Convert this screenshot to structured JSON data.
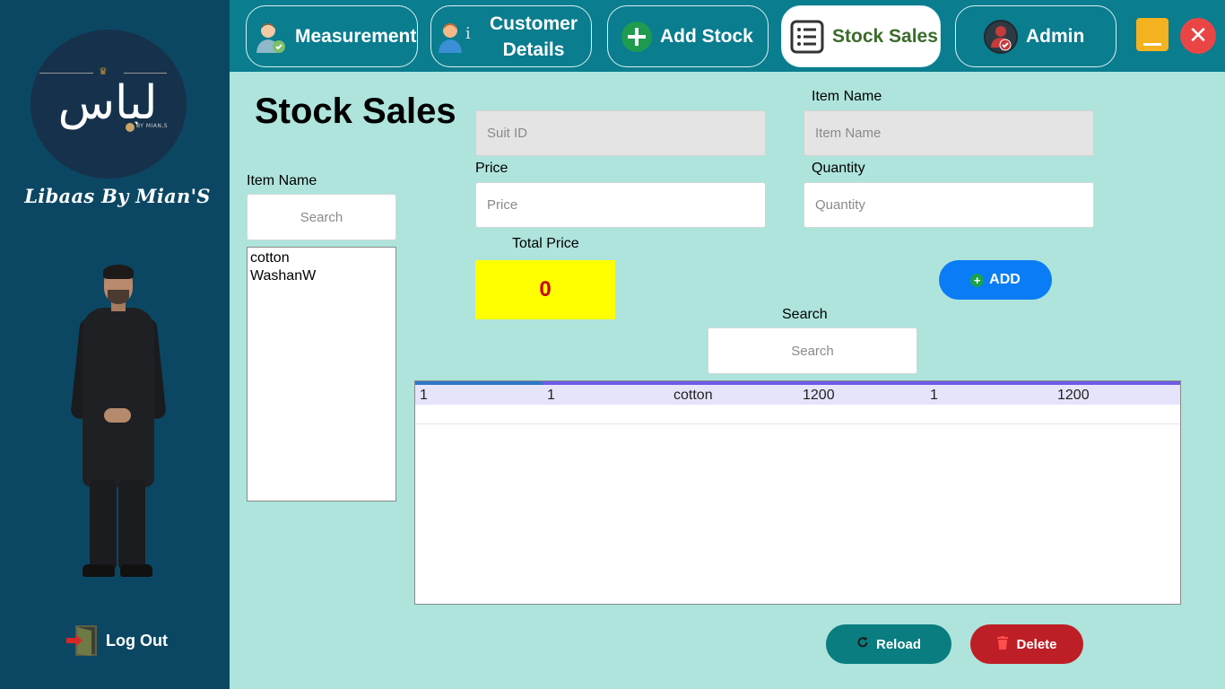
{
  "sidebar": {
    "logo_text": "لباس",
    "logo_sub": "BY MIAN,S",
    "brand_name": "Libaas By Mian'S",
    "logout_label": "Log Out"
  },
  "nav": {
    "measurement": "Measurement",
    "customer_line1": "Customer",
    "customer_line2": "Details",
    "add_stock": "Add Stock",
    "stock_sales": "Stock Sales",
    "admin": "Admin"
  },
  "page": {
    "title": "Stock Sales",
    "left_item_label": "Item Name",
    "left_search_placeholder": "Search",
    "items": [
      "cotton",
      "WashanW"
    ],
    "suit_id_placeholder": "Suit ID",
    "item_name_label": "Item Name",
    "item_name_placeholder": "Item Name",
    "price_label": "Price",
    "price_placeholder": "Price",
    "quantity_label": "Quantity",
    "quantity_placeholder": "Quantity",
    "total_price_label": "Total Price",
    "total_price_value": "0",
    "add_label": "ADD",
    "search_label": "Search",
    "search_placeholder": "Search",
    "reload_label": "Reload",
    "delete_label": "Delete"
  },
  "table": {
    "rows": [
      [
        "1",
        "1",
        "cotton",
        "1200",
        "1",
        "1200"
      ]
    ]
  },
  "colors": {
    "sidebar": "#0b4763",
    "topbar": "#0a7d8f",
    "main_bg": "#aee4dc",
    "total_box": "#ffff00",
    "add_button": "#0a7cf5",
    "reload_button": "#0a7d80",
    "delete_button": "#be1e26"
  }
}
